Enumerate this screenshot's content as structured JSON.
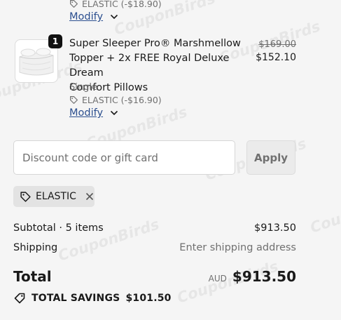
{
  "item_prev": {
    "discount_label": "ELASTIC (-$18.90)",
    "modify_label": "Modify"
  },
  "item": {
    "quantity": "1",
    "title_lines": [
      "Super Sleeper Pro® Marshmellow",
      "Topper + 2x FREE Royal Deluxe Dream",
      "Comfort Pillows"
    ],
    "variant": "Single",
    "discount_label": "ELASTIC (-$16.90)",
    "modify_label": "Modify",
    "original_price": "$169.00",
    "price": "$152.10"
  },
  "discount": {
    "placeholder": "Discount code or gift card",
    "apply_label": "Apply",
    "applied_code": "ELASTIC"
  },
  "summary": {
    "subtotal_label": "Subtotal · 5 items",
    "subtotal_value": "$913.50",
    "shipping_label": "Shipping",
    "shipping_value": "Enter shipping address",
    "total_label": "Total",
    "currency": "AUD",
    "total_value": "$913.50",
    "savings_label": "TOTAL SAVINGS",
    "savings_value": "$101.50"
  },
  "watermark": "CouponBirds",
  "colors": {
    "link": "#2c4f8f",
    "badge_bg": "#111111",
    "page_bg": "#f5f5f5"
  }
}
